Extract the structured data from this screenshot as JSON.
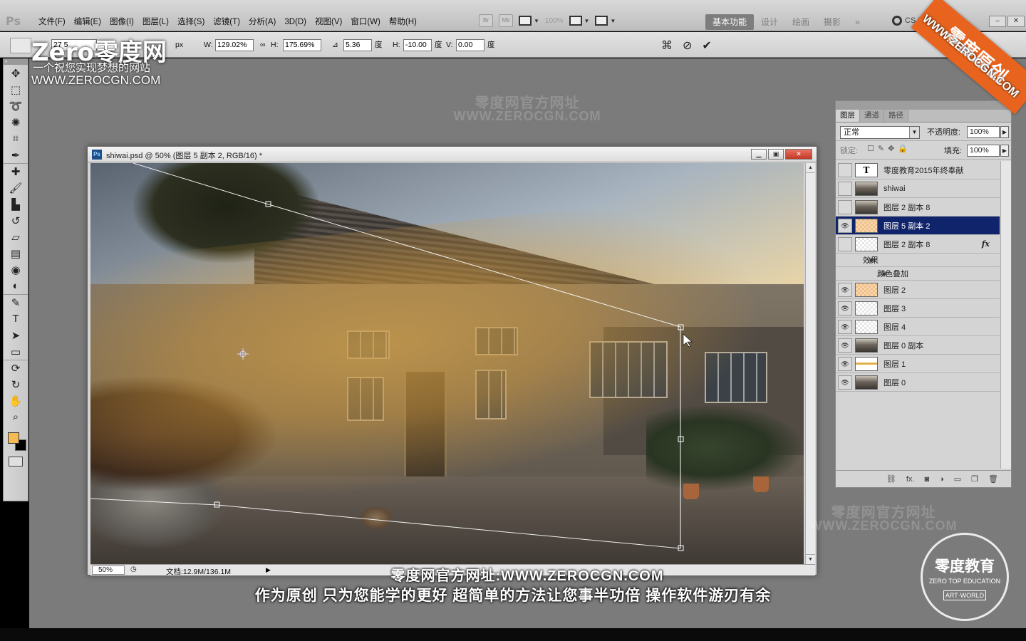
{
  "app": {
    "logo": "Ps"
  },
  "menu": [
    "文件(F)",
    "编辑(E)",
    "图像(I)",
    "图层(L)",
    "选择(S)",
    "滤镜(T)",
    "分析(A)",
    "3D(D)",
    "视图(V)",
    "窗口(W)",
    "帮助(H)"
  ],
  "menubar": {
    "br_label": "Br",
    "mb_label": "Mb",
    "zoom": "100%",
    "workspaces": [
      "基本功能",
      "设计",
      "绘画",
      "摄影"
    ],
    "more": "»",
    "cs_live": "CS Live",
    "win_min": "–",
    "win_close": "✕"
  },
  "options": {
    "x_value": "27 5",
    "x_unit": "px",
    "w_label": "W:",
    "w_value": "129.02%",
    "h_label": "H:",
    "h_value": "175.69%",
    "angle_value": "5.36",
    "angle_unit": "度",
    "hskew_label": "H:",
    "hskew_value": "-10.00",
    "hskew_unit": "度",
    "vskew_label": "V:",
    "vskew_value": "0.00",
    "vskew_unit": "度"
  },
  "tools": [
    "move-tool",
    "marquee-tool",
    "lasso-tool",
    "quick-select-tool",
    "crop-tool",
    "eyedropper-tool",
    "healing-brush-tool",
    "brush-tool",
    "clone-stamp-tool",
    "history-brush-tool",
    "eraser-tool",
    "gradient-tool",
    "blur-tool",
    "dodge-tool",
    "pen-tool",
    "type-tool",
    "path-select-tool",
    "shape-tool",
    "3d-rotate-tool",
    "3d-orbit-tool",
    "hand-tool",
    "zoom-tool"
  ],
  "colors": {
    "foreground": "#f5b955",
    "background": "#000000",
    "accent": "#10246b",
    "brand_orange": "#e8641e"
  },
  "document": {
    "title": "shiwai.psd @ 50% (图层 5 副本 2, RGB/16) *",
    "zoom": "50%",
    "status": "文档:12.9M/136.1M"
  },
  "layers_panel": {
    "tabs": [
      "图层",
      "通道",
      "路径"
    ],
    "blend_mode": "正常",
    "opacity_label": "不透明度:",
    "opacity": "100%",
    "lock_label": "锁定:",
    "fill_label": "填充:",
    "fill": "100%",
    "layers": [
      {
        "name": "零度教育2015年终奉献",
        "visible": false,
        "thumb": "text",
        "thumb_glyph": "T"
      },
      {
        "name": "shiwai",
        "visible": false,
        "thumb": "photo"
      },
      {
        "name": "图层 2 副本 8",
        "visible": false,
        "thumb": "photo"
      },
      {
        "name": "图层 5 副本 2",
        "visible": true,
        "thumb": "orange",
        "selected": true
      },
      {
        "name": "图层 2 副本 8",
        "visible": false,
        "thumb": "checker",
        "fx": "fx"
      },
      {
        "name": "效果",
        "sub": true
      },
      {
        "name": "颜色叠加",
        "sub": true,
        "deep": true
      },
      {
        "name": "图层 2",
        "visible": true,
        "thumb": "orange"
      },
      {
        "name": "图层 3",
        "visible": true,
        "thumb": "checker"
      },
      {
        "name": "图层 4",
        "visible": true,
        "thumb": "checker"
      },
      {
        "name": "图层 0 副本",
        "visible": true,
        "thumb": "photo"
      },
      {
        "name": "图层 1",
        "visible": true,
        "thumb": "line"
      },
      {
        "name": "图层 0",
        "visible": true,
        "thumb": "photo"
      }
    ],
    "footer_icons": [
      "link-icon",
      "fx-icon",
      "mask-icon",
      "adjustment-icon",
      "folder-icon",
      "new-layer-icon",
      "trash-icon"
    ]
  },
  "watermark": {
    "logo": "Zero零度网",
    "tagline": "一个祝您实现梦想的网站",
    "url": "WWW.ZEROCGN.COM",
    "center_title": "零度网官方网址",
    "center_url": "WWW.ZEROCGN.COM",
    "ribbon": "零度原创",
    "ribbon_url": "WWW.ZEROCGN.COM",
    "badge_title": "零度教育",
    "badge_sub": "ZERO TOP EDUCATION",
    "badge_mark": "ART·WORLD"
  },
  "captions": {
    "line1": "零度网官方网址:WWW.ZEROCGN.COM",
    "line2": "作为原创 只为您能学的更好 超简单的方法让您事半功倍 操作软件游刃有余"
  }
}
